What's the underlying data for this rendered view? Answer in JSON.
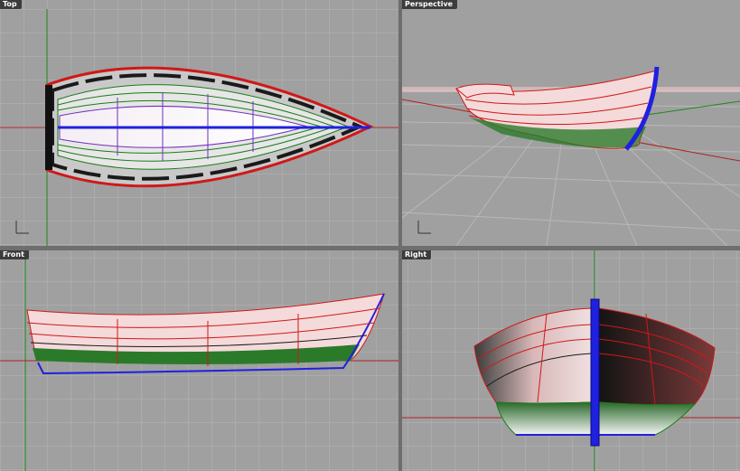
{
  "viewports": {
    "top": {
      "title": "Top"
    },
    "perspective": {
      "title": "Perspective"
    },
    "front": {
      "title": "Front"
    },
    "right": {
      "title": "Right"
    }
  },
  "colors": {
    "viewport_bg": "#a0a0a0",
    "grid": "#b4b4b4",
    "x_axis": "#b02020",
    "y_axis": "#1a8a1a",
    "planking": "#d01818",
    "bottom_planking": "#1a7a1a",
    "keel": "#2020e0",
    "hull_light": "#f2e0e0",
    "hull_dark": "#202020"
  },
  "icons": {
    "axis_indicator": "axis-triad-icon"
  }
}
